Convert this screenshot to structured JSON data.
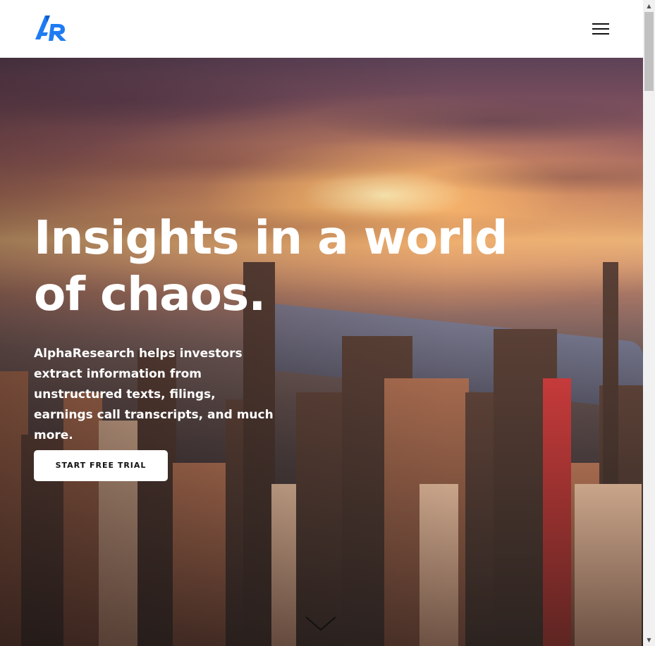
{
  "header": {
    "logo_icon": "alpharesearch-ar-logo",
    "menu_icon": "hamburger-menu-icon",
    "brand_color": "#1e7cf2"
  },
  "hero": {
    "title_line1": "Insights in a world",
    "title_line2": "of chaos.",
    "description": "AlphaResearch helps investors extract information from unstructured texts, filings, earnings call transcripts, and much more.",
    "cta_label": "START FREE TRIAL",
    "scroll_icon": "chevron-down-icon",
    "background": "city-skyline-sunset-photo"
  },
  "scrollbar": {
    "up_arrow": "▲",
    "down_arrow": "▼"
  }
}
